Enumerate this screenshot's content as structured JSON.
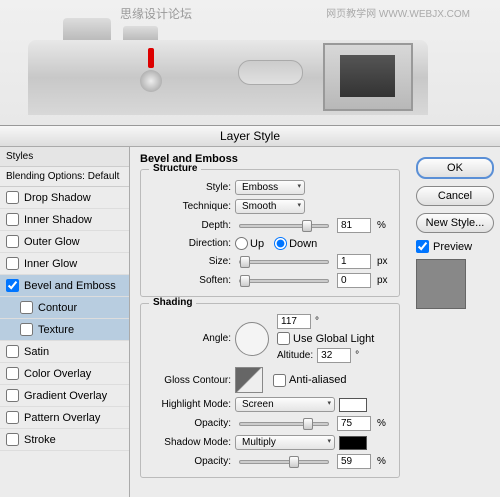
{
  "watermark1": "思缘设计论坛",
  "watermark2": "网页教学网 WWW.WEBJX.COM",
  "dialog_title": "Layer Style",
  "styles": {
    "header": "Styles",
    "subheader": "Blending Options: Default",
    "items": [
      {
        "label": "Drop Shadow",
        "checked": false,
        "sel": false,
        "indent": false
      },
      {
        "label": "Inner Shadow",
        "checked": false,
        "sel": false,
        "indent": false
      },
      {
        "label": "Outer Glow",
        "checked": false,
        "sel": false,
        "indent": false
      },
      {
        "label": "Inner Glow",
        "checked": false,
        "sel": false,
        "indent": false
      },
      {
        "label": "Bevel and Emboss",
        "checked": true,
        "sel": true,
        "indent": false
      },
      {
        "label": "Contour",
        "checked": false,
        "sel": true,
        "indent": true
      },
      {
        "label": "Texture",
        "checked": false,
        "sel": true,
        "indent": true
      },
      {
        "label": "Satin",
        "checked": false,
        "sel": false,
        "indent": false
      },
      {
        "label": "Color Overlay",
        "checked": false,
        "sel": false,
        "indent": false
      },
      {
        "label": "Gradient Overlay",
        "checked": false,
        "sel": false,
        "indent": false
      },
      {
        "label": "Pattern Overlay",
        "checked": false,
        "sel": false,
        "indent": false
      },
      {
        "label": "Stroke",
        "checked": false,
        "sel": false,
        "indent": false
      }
    ]
  },
  "panel": {
    "title": "Bevel and Emboss",
    "structure_label": "Structure",
    "style_label": "Style:",
    "style_value": "Emboss",
    "technique_label": "Technique:",
    "technique_value": "Smooth",
    "depth_label": "Depth:",
    "depth_value": "81",
    "depth_unit": "%",
    "direction_label": "Direction:",
    "dir_up": "Up",
    "dir_down": "Down",
    "size_label": "Size:",
    "size_value": "1",
    "size_unit": "px",
    "soften_label": "Soften:",
    "soften_value": "0",
    "soften_unit": "px",
    "shading_label": "Shading",
    "angle_label": "Angle:",
    "angle_value": "117",
    "global_light": "Use Global Light",
    "altitude_label": "Altitude:",
    "altitude_value": "32",
    "gloss_label": "Gloss Contour:",
    "anti_aliased": "Anti-aliased",
    "highlight_mode_label": "Highlight Mode:",
    "highlight_mode_value": "Screen",
    "hl_opacity_label": "Opacity:",
    "hl_opacity_value": "75",
    "shadow_mode_label": "Shadow Mode:",
    "shadow_mode_value": "Multiply",
    "sh_opacity_label": "Opacity:",
    "sh_opacity_value": "59",
    "pct": "%",
    "deg": "°"
  },
  "buttons": {
    "ok": "OK",
    "cancel": "Cancel",
    "new_style": "New Style...",
    "preview": "Preview"
  }
}
